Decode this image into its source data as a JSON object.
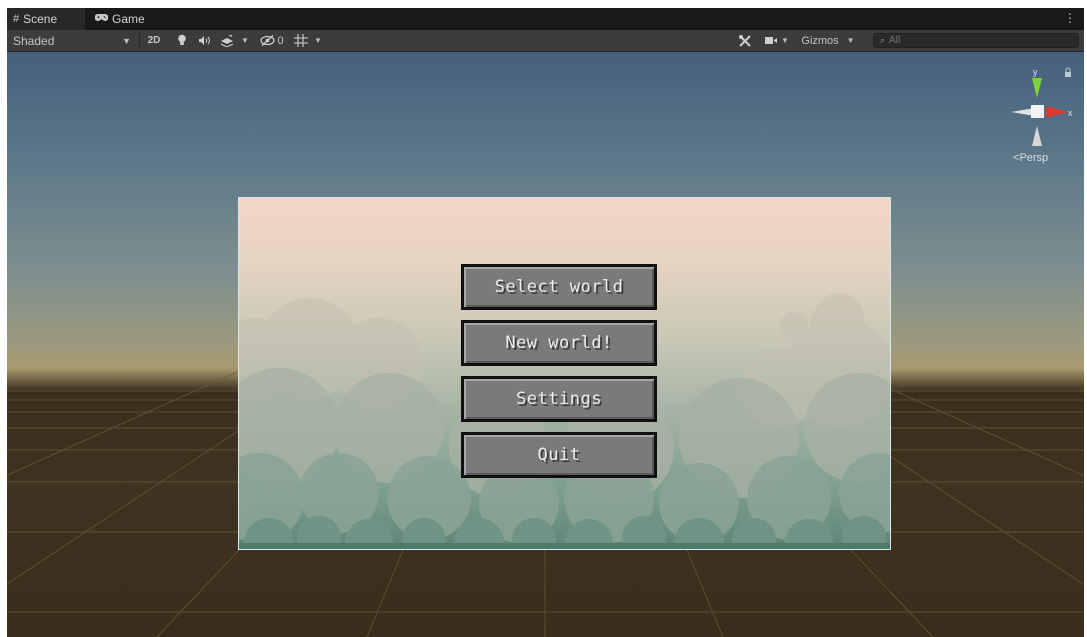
{
  "tabs": [
    {
      "label": "Scene",
      "icon": "grid-hash-icon"
    },
    {
      "label": "Game",
      "icon": "gamepad-icon"
    }
  ],
  "toolbar": {
    "shading_mode": "Shaded",
    "toggle_2d": "2D",
    "hidden_count": "0",
    "gizmos_label": "Gizmos",
    "search_placeholder": "All"
  },
  "scene": {
    "projection_label": "Persp",
    "gizmo_axes": {
      "y": "y",
      "x": "x"
    },
    "menu_buttons": [
      "Select world",
      "New world!",
      "Settings",
      "Quit"
    ]
  },
  "colors": {
    "tab_bar": "#191919",
    "toolbar": "#3c3c3c",
    "axis_x": "#d93b2e",
    "axis_y": "#7ed33a",
    "button_fill": "#7a7a7a",
    "button_border": "#101010"
  }
}
